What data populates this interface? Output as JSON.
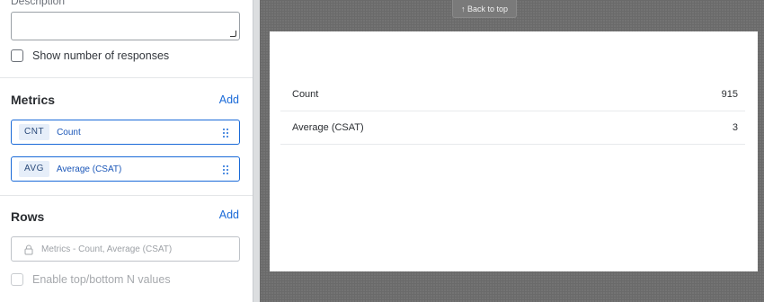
{
  "left_panel": {
    "description_label": "Description",
    "description_value": "",
    "show_responses_label": "Show number of responses",
    "metrics": {
      "title": "Metrics",
      "add_label": "Add",
      "items": [
        {
          "tag": "CNT",
          "name": "Count"
        },
        {
          "tag": "AVG",
          "name": "Average (CSAT)"
        }
      ]
    },
    "rows": {
      "title": "Rows",
      "add_label": "Add",
      "field_text": "Metrics - Count, Average (CSAT)",
      "enable_topn_label": "Enable top/bottom N values"
    }
  },
  "preview": {
    "back_to_top_label": "↑ Back to top",
    "table": [
      {
        "label": "Count",
        "value": "915"
      },
      {
        "label": "Average (CSAT)",
        "value": "3"
      }
    ]
  },
  "colors": {
    "accent": "#1a6ad8",
    "preview_background": "#737373"
  }
}
